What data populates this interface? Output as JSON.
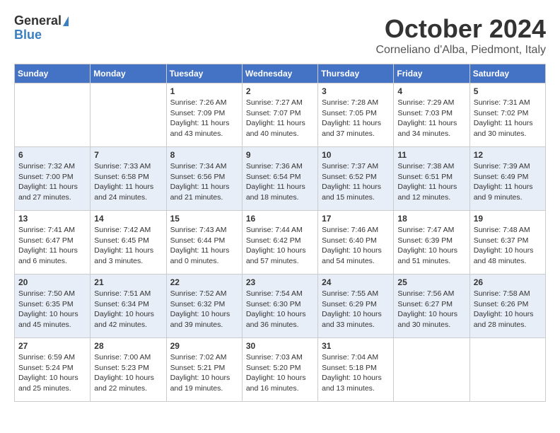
{
  "header": {
    "logo_general": "General",
    "logo_blue": "Blue",
    "month_title": "October 2024",
    "location": "Corneliano d'Alba, Piedmont, Italy"
  },
  "days_of_week": [
    "Sunday",
    "Monday",
    "Tuesday",
    "Wednesday",
    "Thursday",
    "Friday",
    "Saturday"
  ],
  "weeks": [
    [
      {
        "day": "",
        "content": ""
      },
      {
        "day": "",
        "content": ""
      },
      {
        "day": "1",
        "content": "Sunrise: 7:26 AM\nSunset: 7:09 PM\nDaylight: 11 hours and 43 minutes."
      },
      {
        "day": "2",
        "content": "Sunrise: 7:27 AM\nSunset: 7:07 PM\nDaylight: 11 hours and 40 minutes."
      },
      {
        "day": "3",
        "content": "Sunrise: 7:28 AM\nSunset: 7:05 PM\nDaylight: 11 hours and 37 minutes."
      },
      {
        "day": "4",
        "content": "Sunrise: 7:29 AM\nSunset: 7:03 PM\nDaylight: 11 hours and 34 minutes."
      },
      {
        "day": "5",
        "content": "Sunrise: 7:31 AM\nSunset: 7:02 PM\nDaylight: 11 hours and 30 minutes."
      }
    ],
    [
      {
        "day": "6",
        "content": "Sunrise: 7:32 AM\nSunset: 7:00 PM\nDaylight: 11 hours and 27 minutes."
      },
      {
        "day": "7",
        "content": "Sunrise: 7:33 AM\nSunset: 6:58 PM\nDaylight: 11 hours and 24 minutes."
      },
      {
        "day": "8",
        "content": "Sunrise: 7:34 AM\nSunset: 6:56 PM\nDaylight: 11 hours and 21 minutes."
      },
      {
        "day": "9",
        "content": "Sunrise: 7:36 AM\nSunset: 6:54 PM\nDaylight: 11 hours and 18 minutes."
      },
      {
        "day": "10",
        "content": "Sunrise: 7:37 AM\nSunset: 6:52 PM\nDaylight: 11 hours and 15 minutes."
      },
      {
        "day": "11",
        "content": "Sunrise: 7:38 AM\nSunset: 6:51 PM\nDaylight: 11 hours and 12 minutes."
      },
      {
        "day": "12",
        "content": "Sunrise: 7:39 AM\nSunset: 6:49 PM\nDaylight: 11 hours and 9 minutes."
      }
    ],
    [
      {
        "day": "13",
        "content": "Sunrise: 7:41 AM\nSunset: 6:47 PM\nDaylight: 11 hours and 6 minutes."
      },
      {
        "day": "14",
        "content": "Sunrise: 7:42 AM\nSunset: 6:45 PM\nDaylight: 11 hours and 3 minutes."
      },
      {
        "day": "15",
        "content": "Sunrise: 7:43 AM\nSunset: 6:44 PM\nDaylight: 11 hours and 0 minutes."
      },
      {
        "day": "16",
        "content": "Sunrise: 7:44 AM\nSunset: 6:42 PM\nDaylight: 10 hours and 57 minutes."
      },
      {
        "day": "17",
        "content": "Sunrise: 7:46 AM\nSunset: 6:40 PM\nDaylight: 10 hours and 54 minutes."
      },
      {
        "day": "18",
        "content": "Sunrise: 7:47 AM\nSunset: 6:39 PM\nDaylight: 10 hours and 51 minutes."
      },
      {
        "day": "19",
        "content": "Sunrise: 7:48 AM\nSunset: 6:37 PM\nDaylight: 10 hours and 48 minutes."
      }
    ],
    [
      {
        "day": "20",
        "content": "Sunrise: 7:50 AM\nSunset: 6:35 PM\nDaylight: 10 hours and 45 minutes."
      },
      {
        "day": "21",
        "content": "Sunrise: 7:51 AM\nSunset: 6:34 PM\nDaylight: 10 hours and 42 minutes."
      },
      {
        "day": "22",
        "content": "Sunrise: 7:52 AM\nSunset: 6:32 PM\nDaylight: 10 hours and 39 minutes."
      },
      {
        "day": "23",
        "content": "Sunrise: 7:54 AM\nSunset: 6:30 PM\nDaylight: 10 hours and 36 minutes."
      },
      {
        "day": "24",
        "content": "Sunrise: 7:55 AM\nSunset: 6:29 PM\nDaylight: 10 hours and 33 minutes."
      },
      {
        "day": "25",
        "content": "Sunrise: 7:56 AM\nSunset: 6:27 PM\nDaylight: 10 hours and 30 minutes."
      },
      {
        "day": "26",
        "content": "Sunrise: 7:58 AM\nSunset: 6:26 PM\nDaylight: 10 hours and 28 minutes."
      }
    ],
    [
      {
        "day": "27",
        "content": "Sunrise: 6:59 AM\nSunset: 5:24 PM\nDaylight: 10 hours and 25 minutes."
      },
      {
        "day": "28",
        "content": "Sunrise: 7:00 AM\nSunset: 5:23 PM\nDaylight: 10 hours and 22 minutes."
      },
      {
        "day": "29",
        "content": "Sunrise: 7:02 AM\nSunset: 5:21 PM\nDaylight: 10 hours and 19 minutes."
      },
      {
        "day": "30",
        "content": "Sunrise: 7:03 AM\nSunset: 5:20 PM\nDaylight: 10 hours and 16 minutes."
      },
      {
        "day": "31",
        "content": "Sunrise: 7:04 AM\nSunset: 5:18 PM\nDaylight: 10 hours and 13 minutes."
      },
      {
        "day": "",
        "content": ""
      },
      {
        "day": "",
        "content": ""
      }
    ]
  ]
}
